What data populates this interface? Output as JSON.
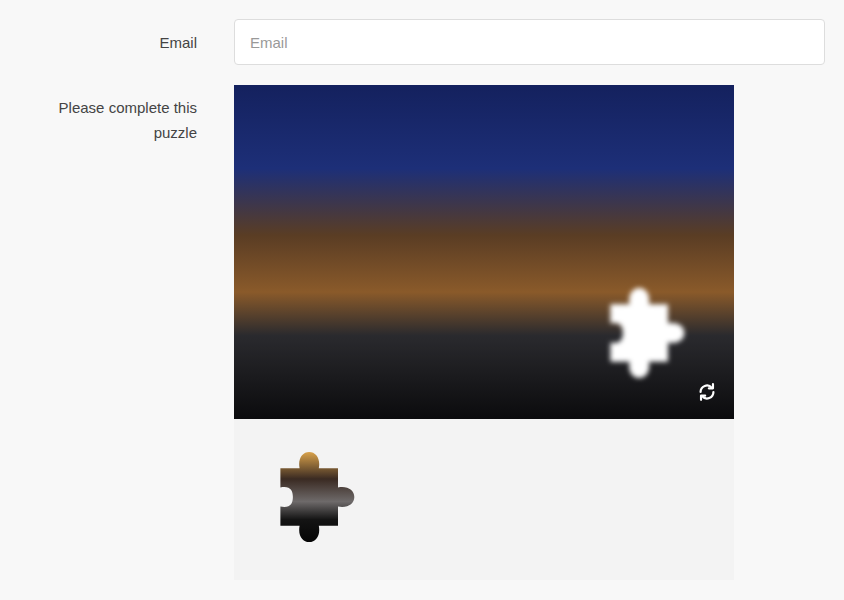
{
  "form": {
    "email": {
      "label": "Email",
      "placeholder": "Email"
    },
    "captcha": {
      "label": "Please complete this puzzle"
    }
  }
}
